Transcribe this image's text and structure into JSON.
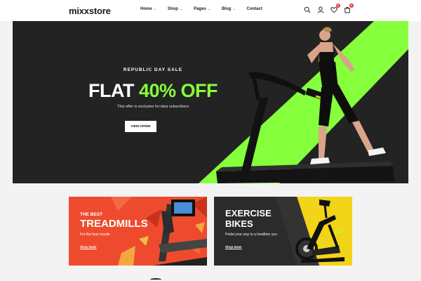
{
  "brand": {
    "logo": "mixxstore"
  },
  "nav": {
    "items": [
      {
        "label": "Home",
        "has_dropdown": true
      },
      {
        "label": "Shop",
        "has_dropdown": true
      },
      {
        "label": "Pages",
        "has_dropdown": true
      },
      {
        "label": "Blog",
        "has_dropdown": true
      },
      {
        "label": "Contact",
        "has_dropdown": false
      }
    ]
  },
  "header_icons": {
    "search": "search-icon",
    "account": "user-icon",
    "wishlist": {
      "icon": "heart-icon",
      "count": "0"
    },
    "cart": {
      "icon": "cart-icon",
      "count": "0"
    }
  },
  "hero": {
    "eyebrow": "REPUBLIC DAY SALE",
    "title_prefix": "FLAT ",
    "title_highlight": "40% OFF",
    "subtitle": "This offer is exclusive for idea subscribers",
    "button": "VIEW OFFER",
    "colors": {
      "background": "#232323",
      "accent": "#86ff3c"
    }
  },
  "promos": [
    {
      "eyebrow": "THE BEST",
      "title": "TREADMILLS",
      "subtitle": "For the best results",
      "link": "Shop Now!",
      "color": "#ee4b2e"
    },
    {
      "title_line1": "EXERCISE",
      "title_line2": "BIKES",
      "subtitle": "Pedal your way to a healthier you",
      "link": "Shop Now!",
      "colors": {
        "background": "#2b2b2b",
        "accent": "#f2d419"
      }
    }
  ]
}
